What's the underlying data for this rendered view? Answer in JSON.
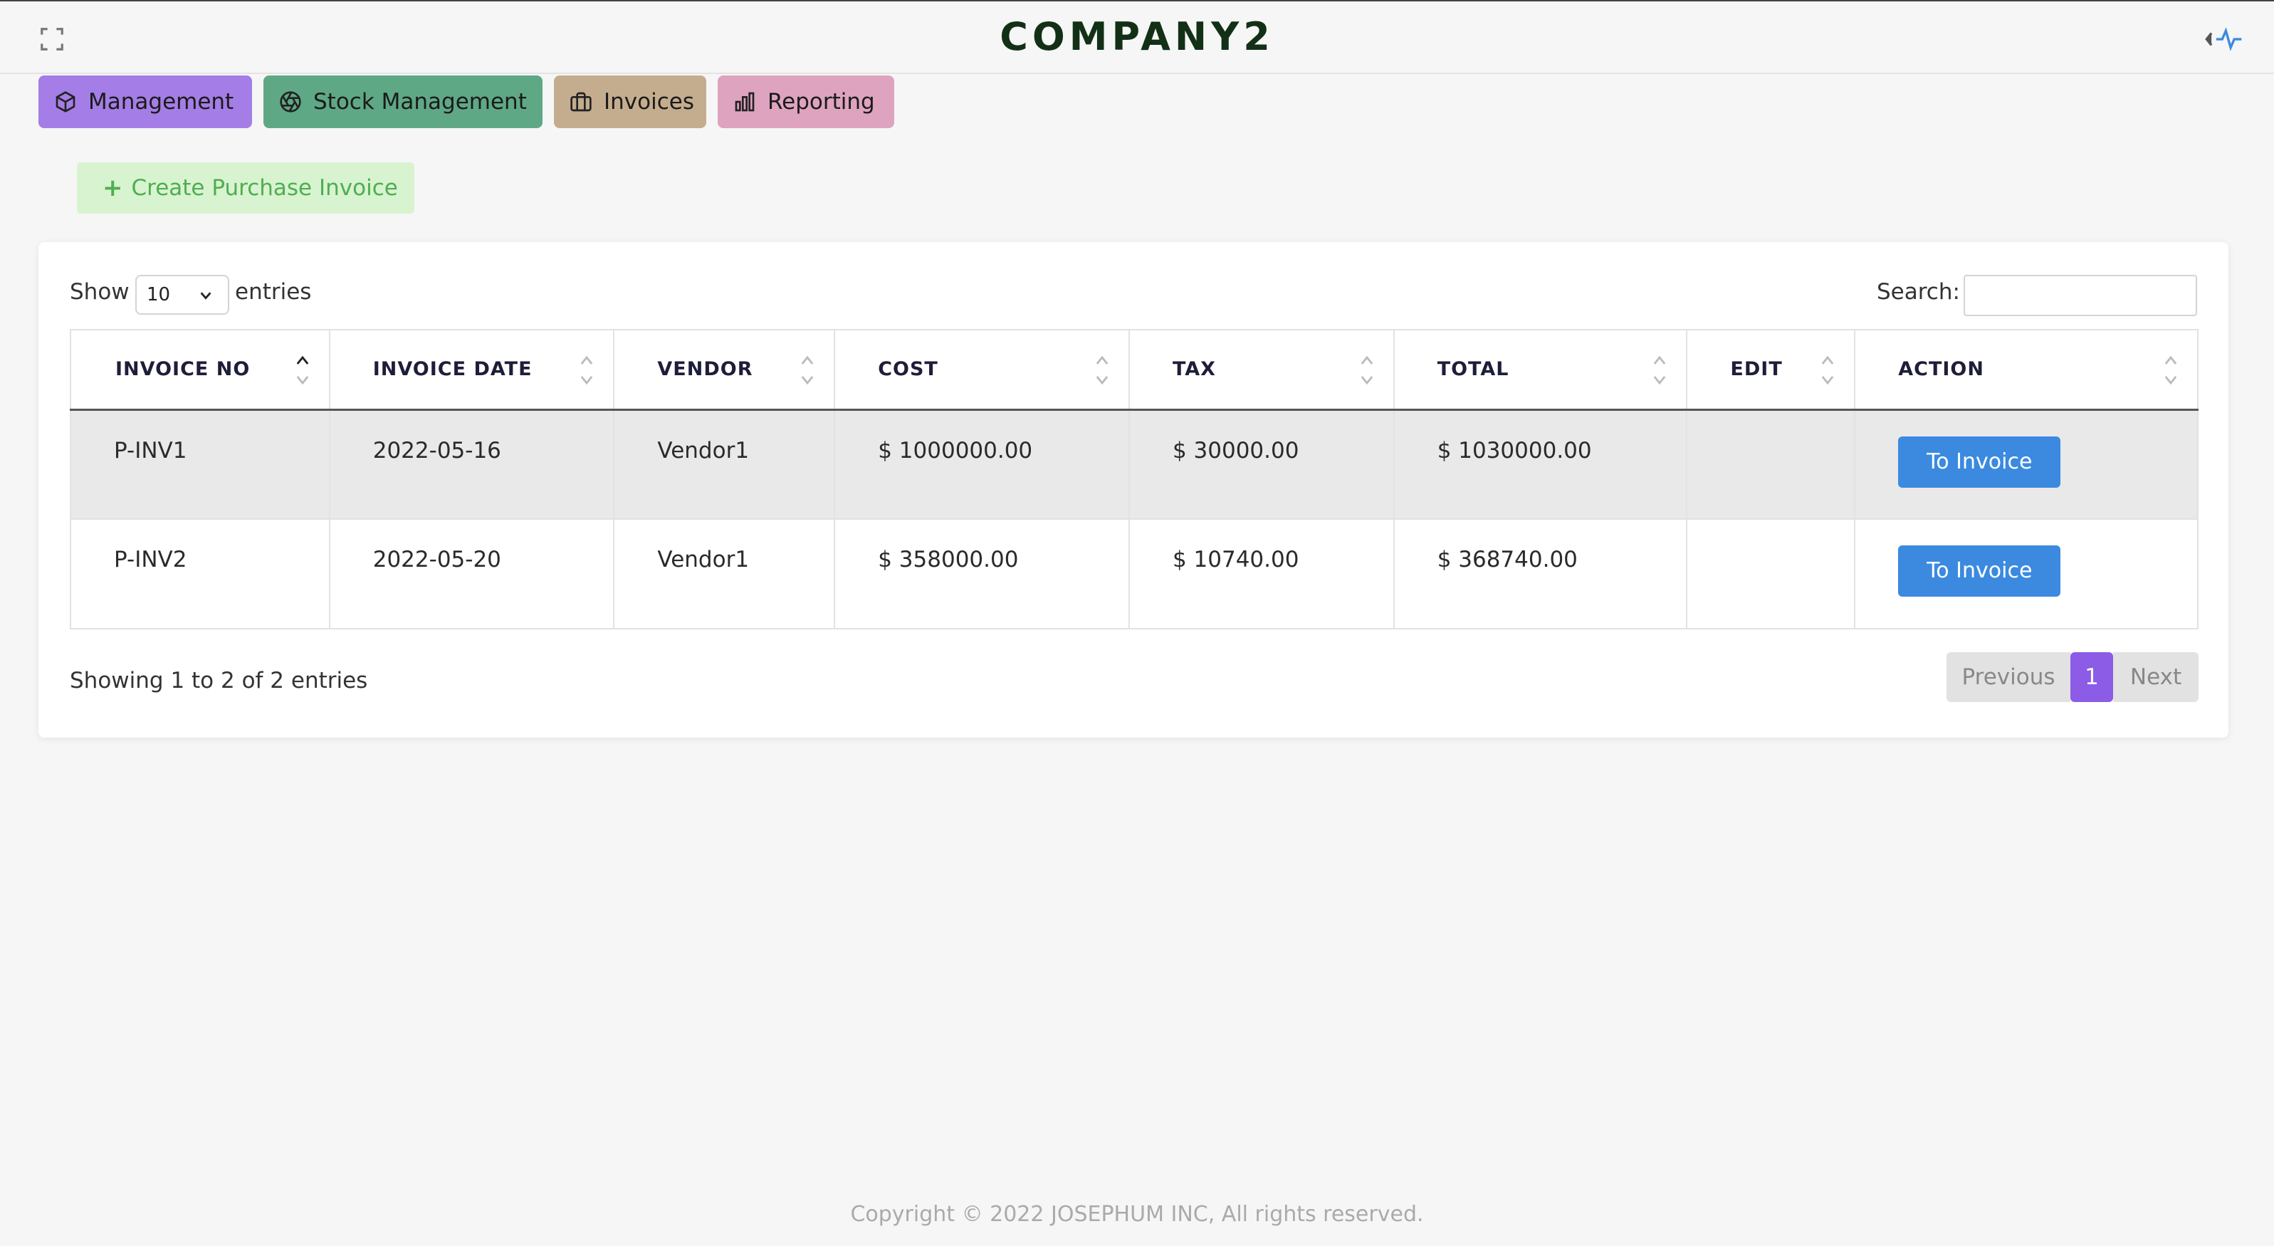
{
  "header": {
    "brand": "COMPANY2",
    "expand_icon": "expand-icon",
    "activity_icon": "activity-pulse-icon"
  },
  "nav": {
    "items": [
      {
        "label": "Management",
        "icon": "box-icon",
        "color": "#a57de6"
      },
      {
        "label": "Stock Management",
        "icon": "aperture-icon",
        "color": "#5fa886"
      },
      {
        "label": "Invoices",
        "icon": "briefcase-icon",
        "color": "#c4ad8e"
      },
      {
        "label": "Reporting",
        "icon": "bar-chart-icon",
        "color": "#dea3bf"
      }
    ]
  },
  "actions": {
    "create_label": "Create Purchase Invoice"
  },
  "table_controls": {
    "show_label": "Show",
    "page_length": "10",
    "entries_label": "entries",
    "search_label": "Search:",
    "search_value": ""
  },
  "table": {
    "columns": [
      "INVOICE NO",
      "INVOICE DATE",
      "VENDOR",
      "COST",
      "TAX",
      "TOTAL",
      "EDIT",
      "ACTION"
    ],
    "rows": [
      {
        "invoice_no": "P-INV1",
        "invoice_date": "2022-05-16",
        "vendor": "Vendor1",
        "cost": "$ 1000000.00",
        "tax": "$ 30000.00",
        "total": "$ 1030000.00",
        "edit": "",
        "action": "To Invoice"
      },
      {
        "invoice_no": "P-INV2",
        "invoice_date": "2022-05-20",
        "vendor": "Vendor1",
        "cost": "$ 358000.00",
        "tax": "$ 10740.00",
        "total": "$ 368740.00",
        "edit": "",
        "action": "To Invoice"
      }
    ]
  },
  "pagination": {
    "info": "Showing 1 to 2 of 2 entries",
    "previous": "Previous",
    "current": "1",
    "next": "Next"
  },
  "footer": {
    "copyright": "Copyright © 2022  JOSEPHUM INC, All rights reserved."
  },
  "colors": {
    "accent": "#8c5ce6",
    "primary_button": "#3b8ae0",
    "create_button_bg": "#d8f3d0",
    "create_button_text": "#4fae51"
  }
}
